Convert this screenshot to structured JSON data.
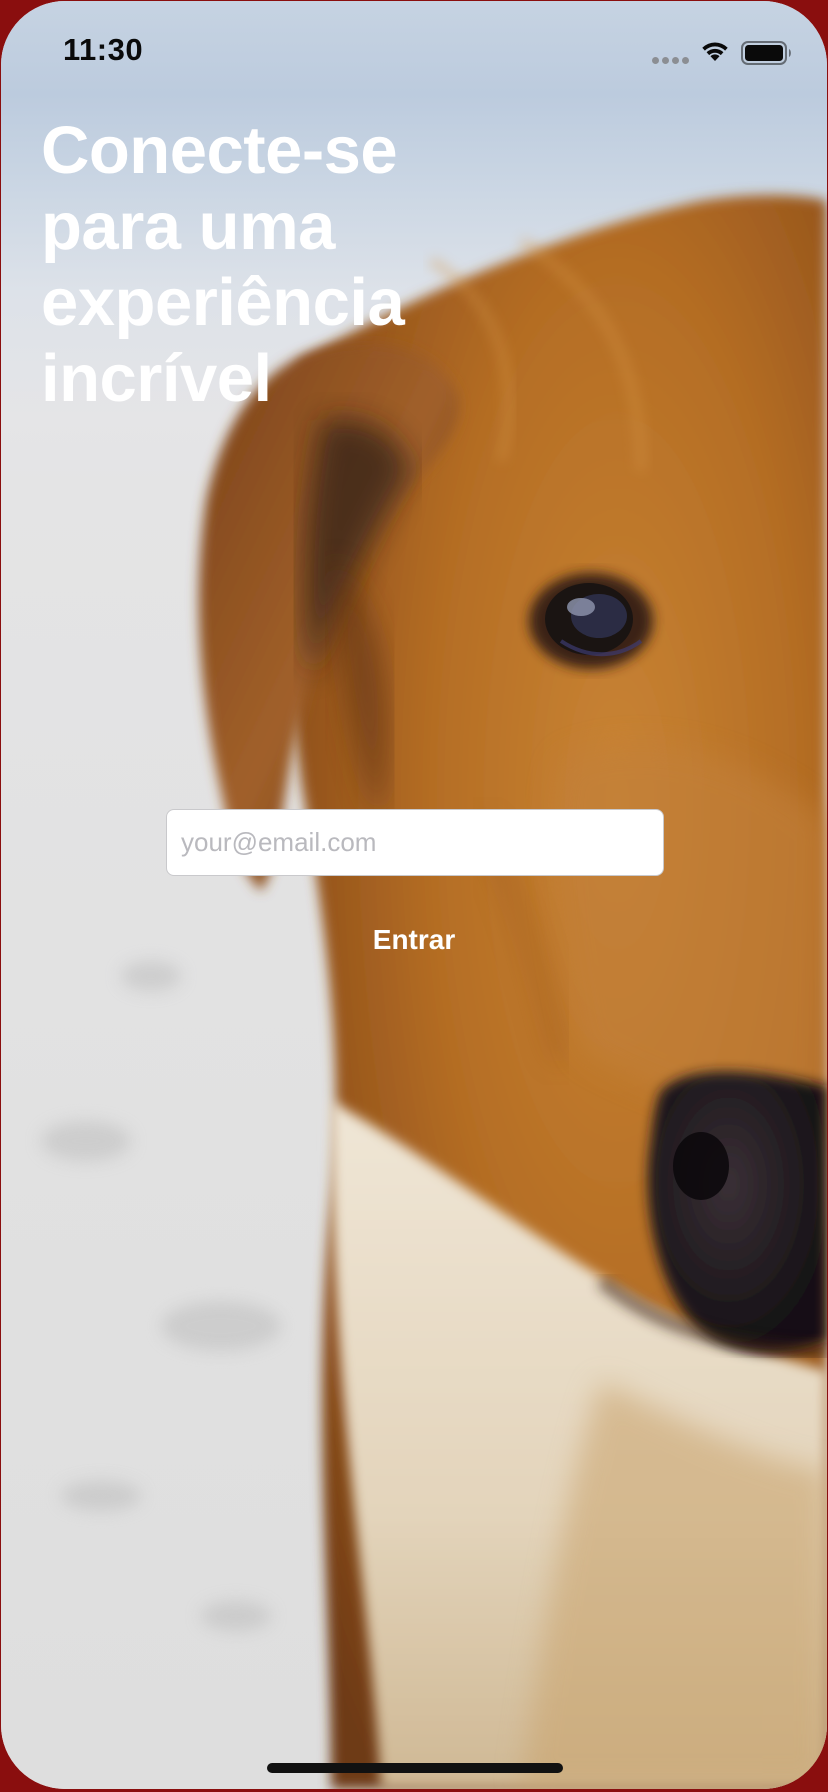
{
  "status_bar": {
    "time": "11:30",
    "time_color": "#0a0a0a"
  },
  "headline": {
    "text": "Conecte-se para uma experiência incrível"
  },
  "login_form": {
    "email_placeholder": "your@email.com",
    "email_value": "",
    "submit_label": "Entrar"
  },
  "background": {
    "subject": "dog-photo",
    "frame_color": "#8a0e0e",
    "fur_color": "#b9752a",
    "sky_color": "#c6d3e2",
    "sand_color": "#e4e3e3"
  },
  "icons": {
    "signal": "cellular-signal-icon",
    "wifi": "wifi-icon",
    "battery": "battery-icon"
  }
}
